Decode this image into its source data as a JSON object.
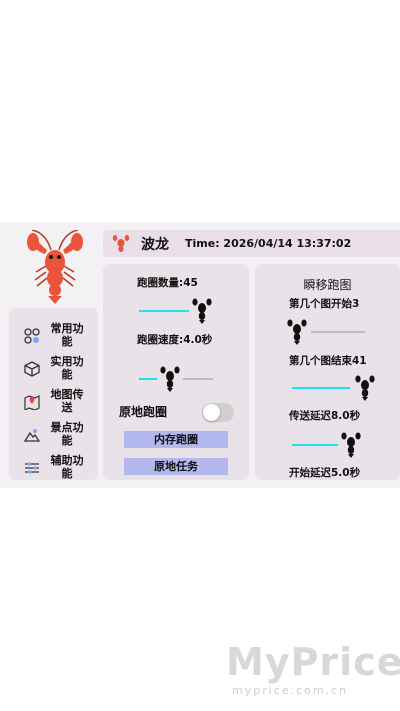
{
  "header": {
    "name": "波龙",
    "time": "Time: 2026/04/14 13:37:02"
  },
  "sidebar": {
    "items": [
      {
        "label": "常用功能",
        "icon": "grid-icon"
      },
      {
        "label": "实用功能",
        "icon": "box-icon"
      },
      {
        "label": "地图传送",
        "icon": "map-pin-icon"
      },
      {
        "label": "景点功能",
        "icon": "landscape-icon"
      },
      {
        "label": "辅助功能",
        "icon": "sliders-icon"
      }
    ]
  },
  "left_panel": {
    "lap_count_label": "跑圈数量:45",
    "lap_speed_label": "跑圈速度:4.0秒",
    "toggle_label": "原地跑圈",
    "toggle_on": false,
    "button_memory": "内存跑圈",
    "button_task": "原地任务"
  },
  "right_panel": {
    "title": "瞬移跑图",
    "start_label": "第几个图开始3",
    "end_label": "第几个图结束41",
    "delay_label": "传送延迟8.0秒",
    "begin_delay_label": "开始延迟5.0秒"
  },
  "colors": {
    "accent": "#22e0f0",
    "button": "#b3b8ee",
    "lobster": "#e8553a"
  },
  "watermark": {
    "big": "MyPrice",
    "small": "myprice.com.cn"
  }
}
